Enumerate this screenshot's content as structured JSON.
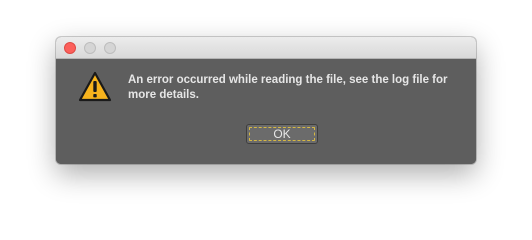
{
  "dialog": {
    "window_controls": {
      "close_icon": "close-icon",
      "minimize_icon": "minimize-icon",
      "zoom_icon": "zoom-icon",
      "close_color": "#fc605b",
      "inactive_color": "#d5d5d5"
    },
    "icon": "warning-icon",
    "icon_colors": {
      "fill": "#f6b31d",
      "stroke": "#1a1a1a"
    },
    "message": "An error occurred while reading the file, see the log file for more details.",
    "ok_label": "OK",
    "focus_ring_color": "#d6b842"
  }
}
